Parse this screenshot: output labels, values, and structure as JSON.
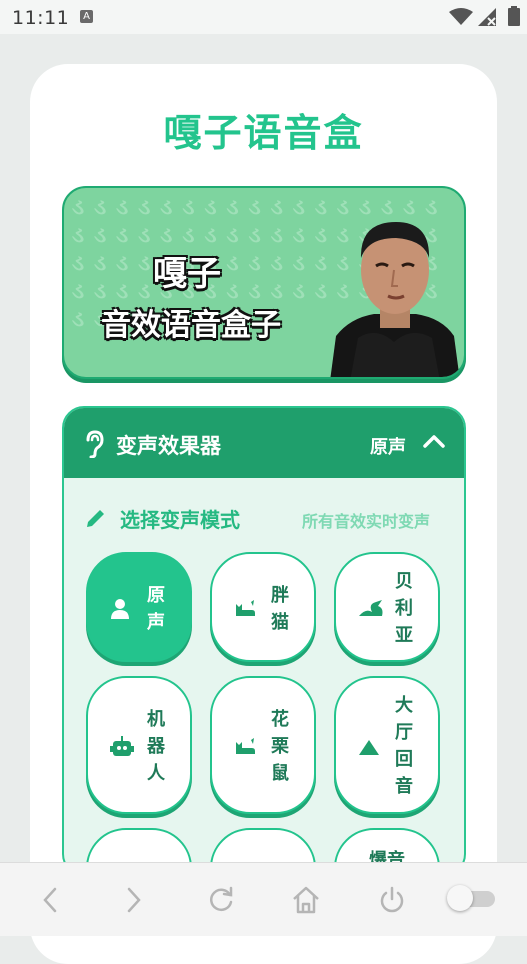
{
  "status_bar": {
    "time": "11:11",
    "notification_letter": "A"
  },
  "app": {
    "title": "嘎子语音盒"
  },
  "banner": {
    "line1": "嘎子",
    "line2": "音效语音盒子"
  },
  "voice_panel": {
    "title": "变声效果器",
    "current_effect": "原声",
    "mode_label": "选择变声模式",
    "mode_hint": "所有音效实时变声",
    "effects": [
      {
        "label": "原声",
        "icon": "person-icon",
        "active": true
      },
      {
        "label": "胖猫",
        "icon": "cat-icon",
        "active": false
      },
      {
        "label": "贝利亚",
        "icon": "dragon-icon",
        "active": false
      },
      {
        "label": "机器人",
        "icon": "robot-icon",
        "active": false
      },
      {
        "label": "花栗鼠",
        "icon": "cat-icon",
        "active": false
      },
      {
        "label": "大厅回音",
        "icon": "mountain-icon",
        "active": false
      },
      {
        "label": "",
        "active": false
      },
      {
        "label": "",
        "active": false
      },
      {
        "label": "爆音",
        "active": false
      }
    ]
  },
  "colors": {
    "accent": "#23c48d",
    "header": "#1f9f6c",
    "banner": "#7ed49f"
  },
  "nav": {
    "items": [
      "back-icon",
      "forward-icon",
      "reload-icon",
      "home-icon",
      "power-icon",
      "toggle"
    ]
  }
}
